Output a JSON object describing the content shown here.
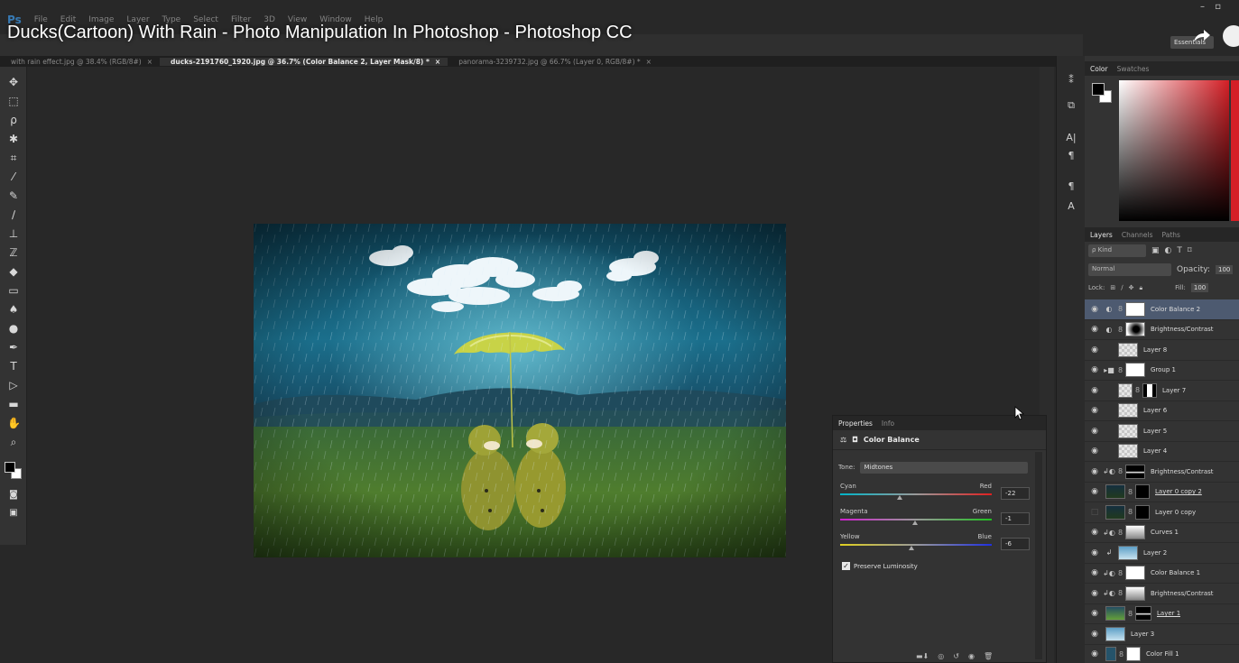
{
  "app": {
    "logo": "Ps",
    "menu": [
      "File",
      "Edit",
      "Image",
      "Layer",
      "Type",
      "Select",
      "Filter",
      "3D",
      "View",
      "Window",
      "Help"
    ],
    "video_title": "Ducks(Cartoon) With Rain - Photo Manipulation In Photoshop - Photoshop CC",
    "workspace": "Essentials"
  },
  "tabs": [
    {
      "label": "with rain effect.jpg @ 38.4% (RGB/8#)",
      "close": "×"
    },
    {
      "label": "ducks-2191760_1920.jpg @ 36.7% (Color Balance 2, Layer Mask/8) *",
      "close": "×"
    },
    {
      "label": "panorama-3239732.jpg @ 66.7% (Layer 0, RGB/8#) *",
      "close": "×"
    }
  ],
  "color_panel": {
    "tabs": [
      "Color",
      "Swatches"
    ],
    "active_tab": "Color",
    "foreground": "#000000",
    "background": "#ffffff",
    "hue_color": "#d41f26"
  },
  "layers_panel": {
    "tabs": [
      "Layers",
      "Channels",
      "Paths"
    ],
    "active_tab": "Layers",
    "filter_kind": "ρ Kind",
    "blend_mode": "Normal",
    "opacity_label": "Opacity:",
    "opacity_value": "100",
    "lock_label": "Lock:",
    "fill_label": "Fill:",
    "fill_value": "100",
    "layers": [
      {
        "name": "Color Balance 2",
        "kind": "adjustment",
        "thumb": "white",
        "selected": true,
        "visible": true
      },
      {
        "name": "Brightness/Contrast",
        "kind": "adjustment",
        "thumb": "dark-mask",
        "visible": true
      },
      {
        "name": "Layer 8",
        "kind": "pixel",
        "thumb": "checker",
        "visible": true
      },
      {
        "name": "Group 1",
        "kind": "group",
        "thumb": "white",
        "visible": true
      },
      {
        "name": "Layer 7",
        "kind": "pixel-mask",
        "thumb": "checker",
        "visible": true
      },
      {
        "name": "Layer 6",
        "kind": "pixel",
        "thumb": "checker",
        "visible": true
      },
      {
        "name": "Layer 5",
        "kind": "pixel",
        "thumb": "checker",
        "visible": true
      },
      {
        "name": "Layer 4",
        "kind": "pixel",
        "thumb": "checker",
        "visible": true
      },
      {
        "name": "Brightness/Contrast",
        "kind": "clipped-adjustment",
        "thumb": "line-mask",
        "visible": true
      },
      {
        "name": "Layer 0 copy 2",
        "kind": "pixel-mask",
        "thumb": "photo",
        "visible": true,
        "underline": true
      },
      {
        "name": "Layer 0 copy",
        "kind": "pixel-mask",
        "thumb": "photo",
        "visible": false
      },
      {
        "name": "Curves 1",
        "kind": "clipped-adjustment",
        "thumb": "grad-mask",
        "visible": true
      },
      {
        "name": "Layer 2",
        "kind": "clipped-pixel",
        "thumb": "sky",
        "visible": true
      },
      {
        "name": "Color Balance 1",
        "kind": "clipped-adjustment",
        "thumb": "white",
        "visible": true
      },
      {
        "name": "Brightness/Contrast",
        "kind": "clipped-adjustment",
        "thumb": "grad-mask",
        "visible": true
      },
      {
        "name": "Layer 1",
        "kind": "pixel-mask",
        "thumb": "green",
        "visible": true,
        "underline": true
      },
      {
        "name": "Layer 3",
        "kind": "pixel",
        "thumb": "sky",
        "visible": true
      },
      {
        "name": "Color Fill 1",
        "kind": "fill",
        "thumb": "teal",
        "visible": true
      }
    ]
  },
  "properties_panel": {
    "tabs": [
      "Properties",
      "Info"
    ],
    "active_tab": "Properties",
    "title": "Color Balance",
    "tone_label": "Tone:",
    "tone_value": "Midtones",
    "sliders": [
      {
        "left": "Cyan",
        "right": "Red",
        "value": "-22",
        "fraction": 0.39,
        "track": "linear-gradient(to right,#00b4c8,#9a9a9a,#e02020)"
      },
      {
        "left": "Magenta",
        "right": "Green",
        "value": "-1",
        "fraction": 0.495,
        "track": "linear-gradient(to right,#d020d0,#9a9a9a,#20c020)"
      },
      {
        "left": "Yellow",
        "right": "Blue",
        "value": "-6",
        "fraction": 0.47,
        "track": "linear-gradient(to right,#e0d020,#9a9a9a,#2030e0)"
      }
    ],
    "preserve_label": "Preserve Luminosity",
    "preserve_checked": true
  },
  "toolbar": {
    "tools": [
      "move-tool",
      "marquee-tool",
      "lasso-tool",
      "magic-wand-tool",
      "crop-tool",
      "eyedropper-tool",
      "healing-brush-tool",
      "brush-tool",
      "clone-stamp-tool",
      "history-brush-tool",
      "eraser-tool",
      "gradient-tool",
      "blur-tool",
      "dodge-tool",
      "pen-tool",
      "type-tool",
      "path-selection-tool",
      "shape-tool",
      "hand-tool",
      "zoom-tool"
    ]
  }
}
